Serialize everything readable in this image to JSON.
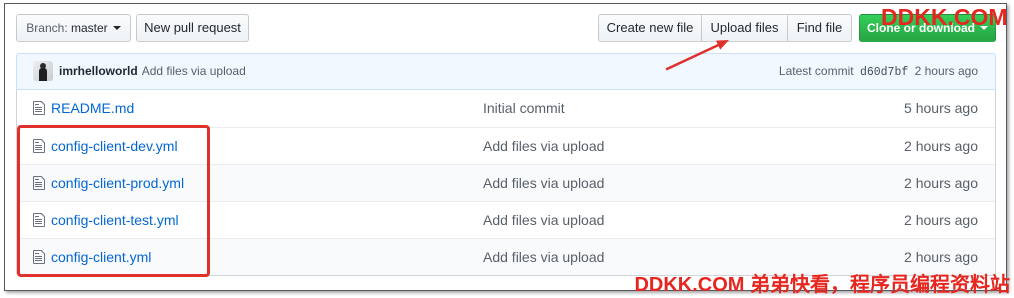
{
  "toolbar": {
    "branch_prefix": "Branch:",
    "branch_name": "master",
    "new_pull_request": "New pull request",
    "create_new_file": "Create new file",
    "upload_files": "Upload files",
    "find_file": "Find file",
    "clone_or_download": "Clone or download"
  },
  "commit_bar": {
    "author": "imrhelloworld",
    "message": "Add files via upload",
    "latest_commit_label": "Latest commit",
    "sha": "d60d7bf",
    "age": "2 hours ago"
  },
  "files": [
    {
      "name": "README.md",
      "message": "Initial commit",
      "age": "5 hours ago"
    },
    {
      "name": "config-client-dev.yml",
      "message": "Add files via upload",
      "age": "2 hours ago"
    },
    {
      "name": "config-client-prod.yml",
      "message": "Add files via upload",
      "age": "2 hours ago"
    },
    {
      "name": "config-client-test.yml",
      "message": "Add files via upload",
      "age": "2 hours ago"
    },
    {
      "name": "config-client.yml",
      "message": "Add files via upload",
      "age": "2 hours ago"
    }
  ],
  "watermarks": {
    "top": "DDKK.COM",
    "bottom": "DDKK.COM 弟弟快看，程序员编程资料站"
  },
  "icons": {
    "file": "file-text-icon",
    "caret": "caret-down-icon"
  },
  "colors": {
    "link": "#0366d6",
    "muted_text": "#586069",
    "primary_button": "#28a745",
    "commit_bar_bg": "#f1f8ff",
    "annotation_red": "#e0302b"
  }
}
